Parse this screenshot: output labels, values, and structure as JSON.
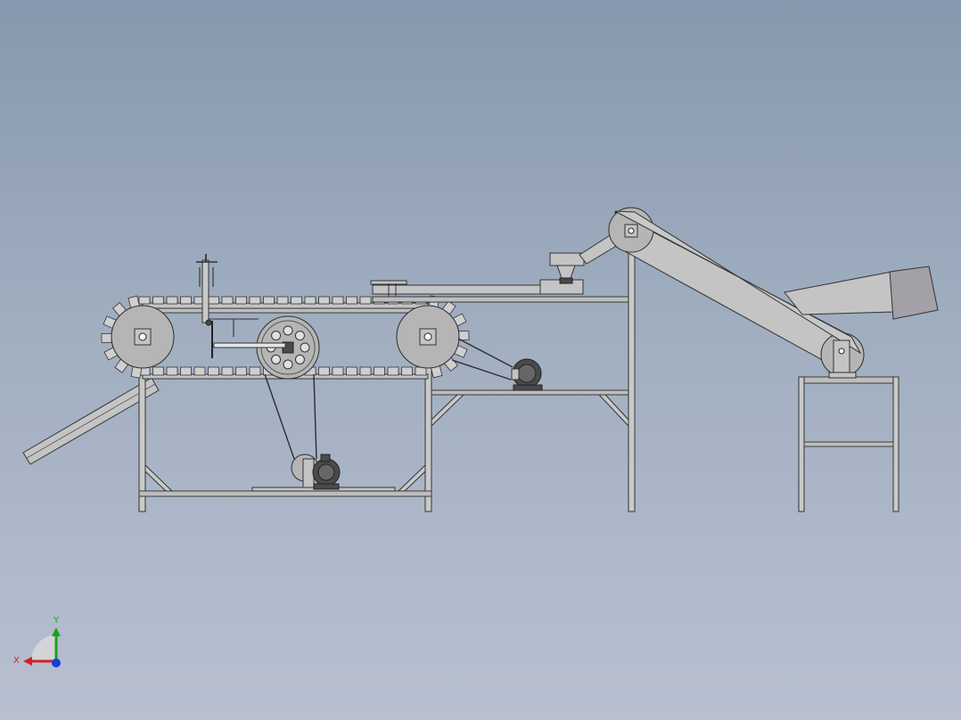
{
  "axis_triad": {
    "x_label": "X",
    "y_label": "Y",
    "x_color": "#d62020",
    "y_color": "#1fa01f",
    "z_color": "#1a3fd6"
  },
  "colors": {
    "background_top": "#8798ae",
    "background_bottom": "#b8c0d0",
    "metal": "#bdbdbd",
    "edge": "#333333"
  }
}
